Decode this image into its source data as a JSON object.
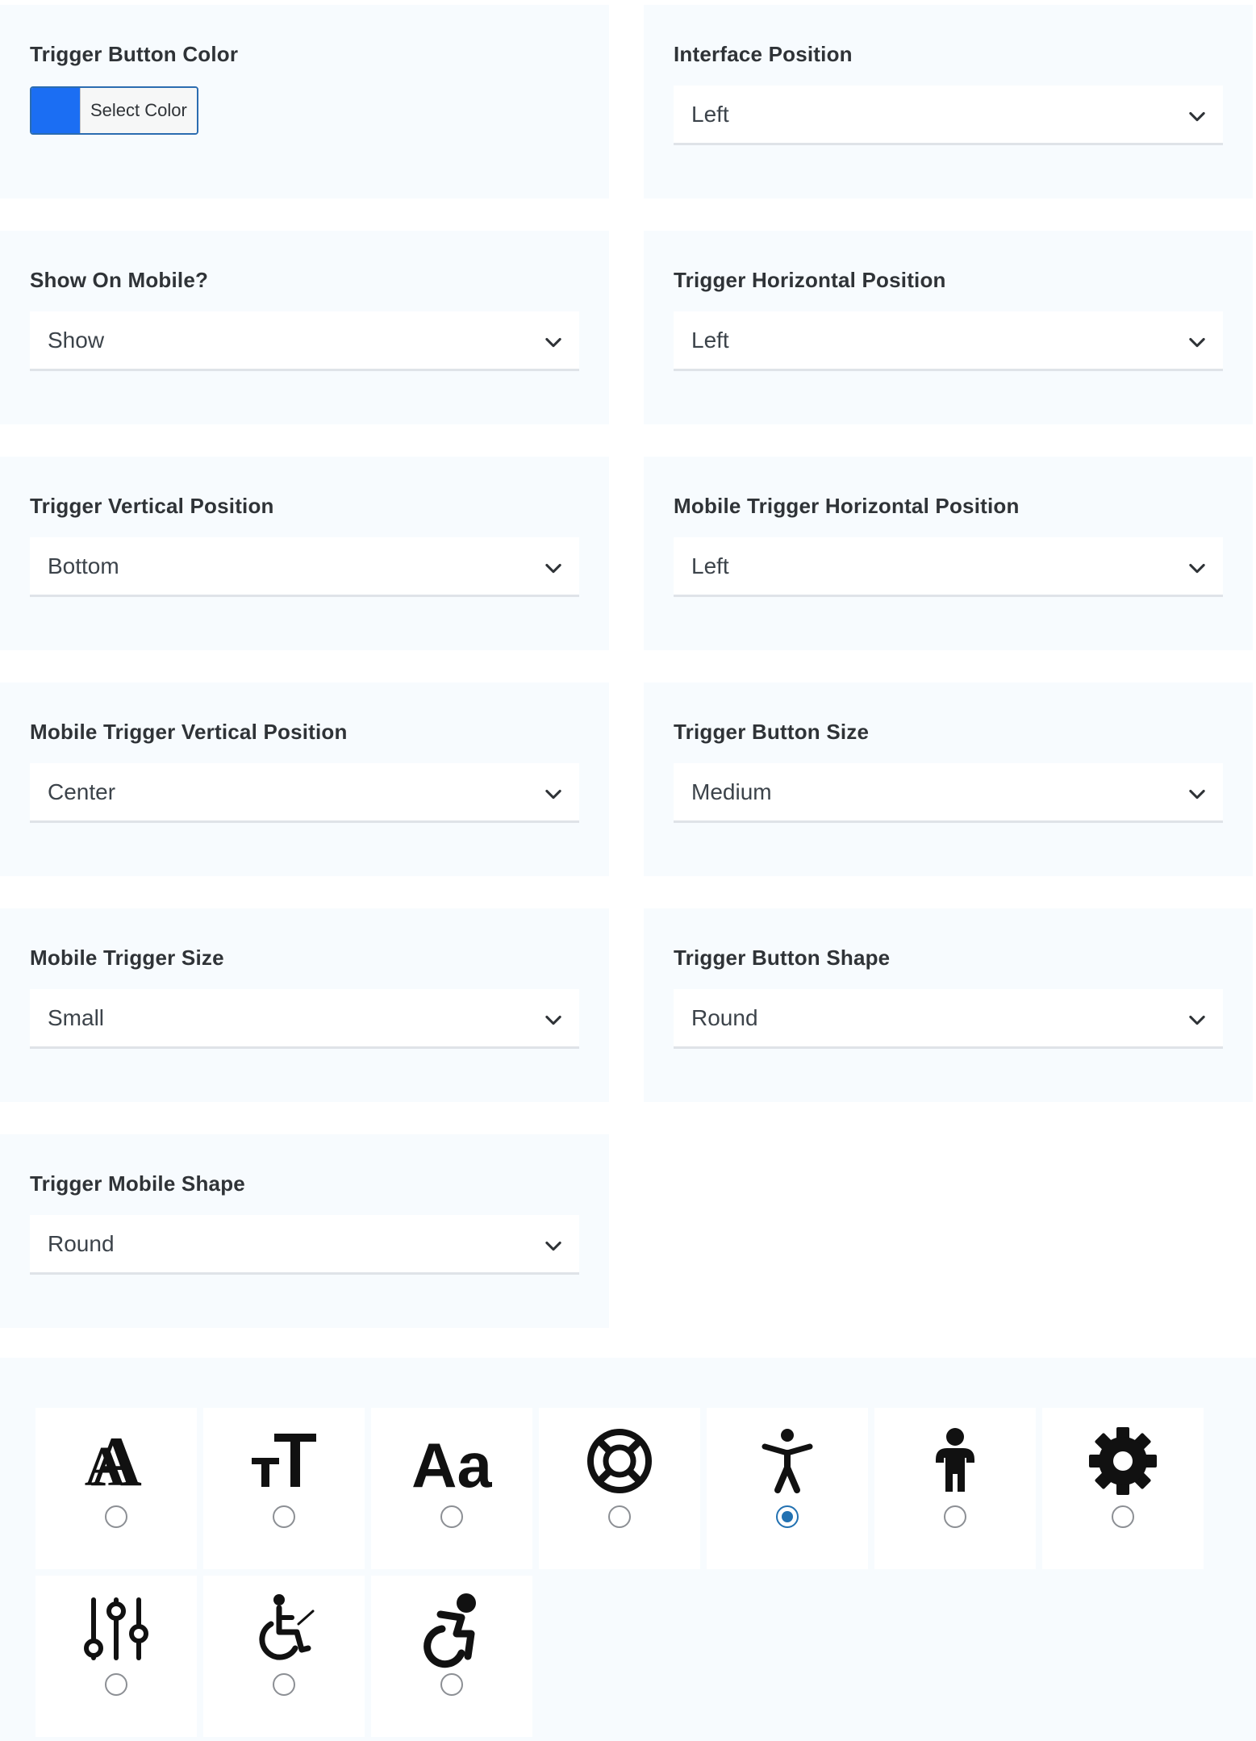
{
  "fields": {
    "trigger_button_color": {
      "label": "Trigger Button Color",
      "button_text": "Select Color",
      "swatch_color": "#1b6ef3"
    },
    "interface_position": {
      "label": "Interface Position",
      "value": "Left"
    },
    "show_on_mobile": {
      "label": "Show On Mobile?",
      "value": "Show"
    },
    "trigger_horizontal_position": {
      "label": "Trigger Horizontal Position",
      "value": "Left"
    },
    "trigger_vertical_position": {
      "label": "Trigger Vertical Position",
      "value": "Bottom"
    },
    "mobile_trigger_horizontal_position": {
      "label": "Mobile Trigger Horizontal Position",
      "value": "Left"
    },
    "mobile_trigger_vertical_position": {
      "label": "Mobile Trigger Vertical Position",
      "value": "Center"
    },
    "trigger_button_size": {
      "label": "Trigger Button Size",
      "value": "Medium"
    },
    "mobile_trigger_size": {
      "label": "Mobile Trigger Size",
      "value": "Small"
    },
    "trigger_button_shape": {
      "label": "Trigger Button Shape",
      "value": "Round"
    },
    "trigger_mobile_shape": {
      "label": "Trigger Mobile Shape",
      "value": "Round"
    }
  },
  "trigger_icons": [
    {
      "icon": "font-size-aa-icon",
      "selected": false
    },
    {
      "icon": "text-height-icon",
      "selected": false
    },
    {
      "icon": "font-aa-icon",
      "selected": false
    },
    {
      "icon": "life-ring-icon",
      "selected": false
    },
    {
      "icon": "universal-access-person-icon",
      "selected": true
    },
    {
      "icon": "child-person-icon",
      "selected": false
    },
    {
      "icon": "gear-icon",
      "selected": false
    },
    {
      "icon": "sliders-icon",
      "selected": false
    },
    {
      "icon": "wheelchair-icon",
      "selected": false
    },
    {
      "icon": "wheelchair-active-icon",
      "selected": false
    }
  ]
}
